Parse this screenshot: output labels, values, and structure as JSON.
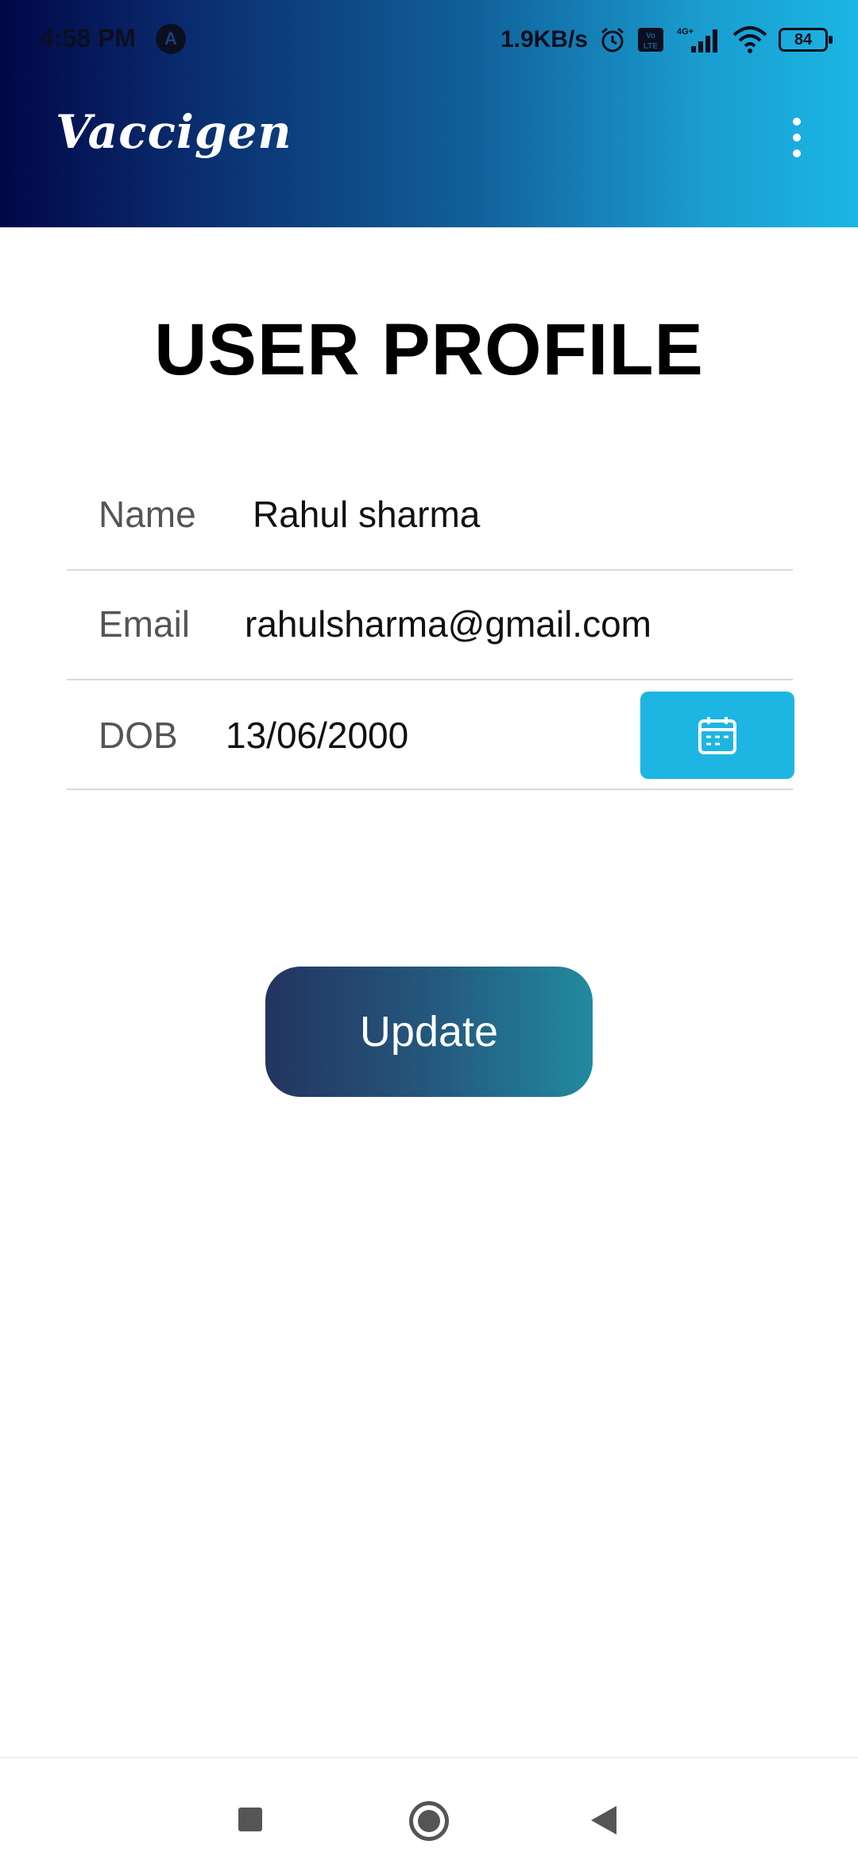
{
  "status_bar": {
    "time": "4:58 PM",
    "net_speed": "1.9KB/s",
    "signal_label": "4G+",
    "volte_label": "Vo LTE",
    "battery": "84",
    "icons": [
      "a-icon",
      "alarm-icon",
      "volte-icon",
      "signal-icon",
      "wifi-icon",
      "battery-icon"
    ]
  },
  "app_bar": {
    "brand": "Vaccigen",
    "menu_icon": "overflow-menu-icon"
  },
  "page": {
    "title": "USER PROFILE"
  },
  "form": {
    "name": {
      "label": "Name",
      "value": "Rahul sharma"
    },
    "email": {
      "label": "Email",
      "value": "rahulsharma@gmail.com"
    },
    "dob": {
      "label": "DOB",
      "value": "13/06/2000",
      "picker_icon": "calendar-icon"
    }
  },
  "actions": {
    "update_label": "Update"
  },
  "nav_bar": {
    "icons": [
      "recents-icon",
      "home-icon",
      "back-icon"
    ]
  },
  "colors": {
    "app_bar_start": "#010748",
    "app_bar_end": "#1bb6e4",
    "calendar_button": "#1db6e2",
    "update_start": "#23345f",
    "update_end": "#218a9e"
  }
}
